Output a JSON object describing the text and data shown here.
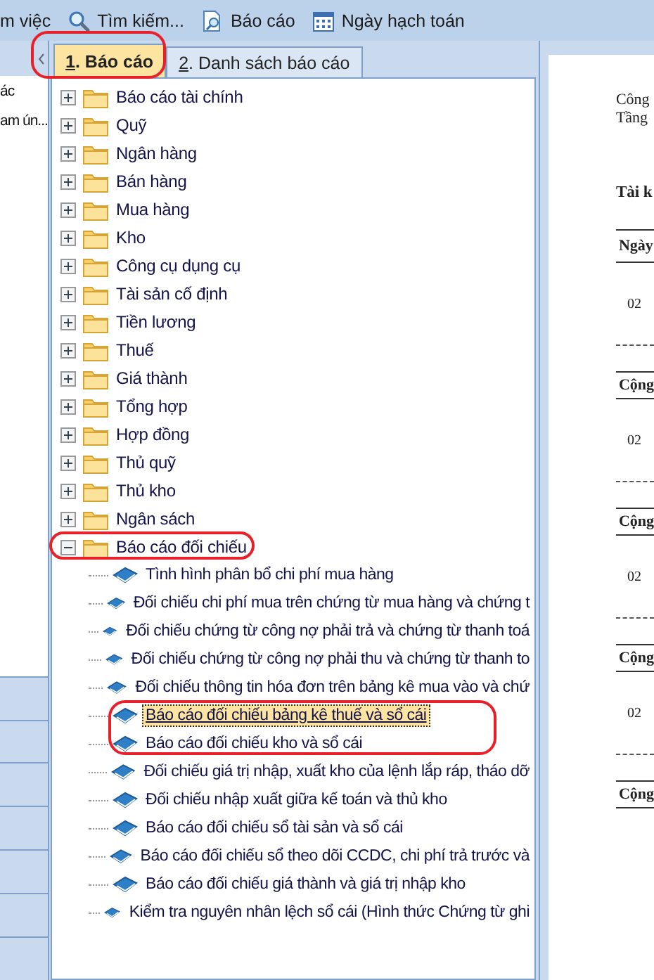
{
  "toolbar": [
    {
      "kind": "text",
      "label": "m việc"
    },
    {
      "kind": "search",
      "label": "Tìm kiếm..."
    },
    {
      "kind": "report",
      "label": "Báo cáo"
    },
    {
      "kind": "calendar",
      "label": "Ngày hạch toán"
    }
  ],
  "left_panel": {
    "items": [
      "ác",
      "am ún..."
    ]
  },
  "tabs": [
    {
      "number": "1",
      "label": ". Báo cáo",
      "selected": true
    },
    {
      "number": "2",
      "label": ". Danh sách báo cáo",
      "selected": false
    }
  ],
  "tree": [
    {
      "kind": "folder",
      "label": "Báo cáo tài chính",
      "expanded": false
    },
    {
      "kind": "folder",
      "label": "Quỹ",
      "expanded": false
    },
    {
      "kind": "folder",
      "label": "Ngân hàng",
      "expanded": false
    },
    {
      "kind": "folder",
      "label": "Bán hàng",
      "expanded": false
    },
    {
      "kind": "folder",
      "label": "Mua hàng",
      "expanded": false
    },
    {
      "kind": "folder",
      "label": "Kho",
      "expanded": false
    },
    {
      "kind": "folder",
      "label": "Công cụ dụng cụ",
      "expanded": false
    },
    {
      "kind": "folder",
      "label": "Tài sản cố định",
      "expanded": false
    },
    {
      "kind": "folder",
      "label": "Tiền lương",
      "expanded": false
    },
    {
      "kind": "folder",
      "label": "Thuế",
      "expanded": false
    },
    {
      "kind": "folder",
      "label": "Giá thành",
      "expanded": false
    },
    {
      "kind": "folder",
      "label": "Tổng hợp",
      "expanded": false
    },
    {
      "kind": "folder",
      "label": "Hợp đồng",
      "expanded": false
    },
    {
      "kind": "folder",
      "label": "Thủ quỹ",
      "expanded": false
    },
    {
      "kind": "folder",
      "label": "Thủ kho",
      "expanded": false
    },
    {
      "kind": "folder",
      "label": "Ngân sách",
      "expanded": false
    },
    {
      "kind": "folder",
      "label": "Báo cáo đối chiếu",
      "expanded": true,
      "children": [
        {
          "kind": "report",
          "label": "Tình hình phân bổ chi phí mua hàng",
          "selected": false
        },
        {
          "kind": "report",
          "label": "Đối chiếu chi phí mua trên chứng từ mua hàng và chứng t",
          "selected": false
        },
        {
          "kind": "report",
          "label": "Đối chiếu chứng từ công nợ phải trả và chứng từ thanh toá",
          "selected": false
        },
        {
          "kind": "report",
          "label": "Đối chiếu chứng từ công nợ phải thu và chứng từ thanh to",
          "selected": false
        },
        {
          "kind": "report",
          "label": "Đối chiếu thông tin hóa đơn trên bảng kê mua vào và chứ",
          "selected": false
        },
        {
          "kind": "report",
          "label": "Báo cáo đối chiếu bảng kê thuế và sổ cái",
          "selected": true
        },
        {
          "kind": "report",
          "label": "Báo cáo đối chiếu kho và sổ cái",
          "selected": false
        },
        {
          "kind": "report",
          "label": "Đối chiếu giá trị nhập, xuất kho của lệnh lắp ráp, tháo dỡ",
          "selected": false
        },
        {
          "kind": "report",
          "label": "Đối chiếu nhập xuất giữa kế toán và thủ kho",
          "selected": false
        },
        {
          "kind": "report",
          "label": "Báo cáo đối chiếu sổ tài sản và sổ cái",
          "selected": false
        },
        {
          "kind": "report",
          "label": "Báo cáo đối chiếu sổ theo dõi CCDC, chi phí trả trước và",
          "selected": false
        },
        {
          "kind": "report",
          "label": "Báo cáo đối chiếu giá thành và giá trị nhập kho",
          "selected": false
        },
        {
          "kind": "report",
          "label": "Kiểm tra nguyên nhân lệch sổ cái (Hình thức Chứng từ ghi",
          "selected": false
        }
      ]
    }
  ],
  "preview": {
    "header_lines": [
      "Công",
      "Tầng"
    ],
    "title": "Tài k",
    "rows": [
      {
        "kind": "header",
        "text": "Ngày"
      },
      {
        "kind": "date",
        "text": "02"
      },
      {
        "kind": "total",
        "text": "Cộng"
      },
      {
        "kind": "date",
        "text": "02"
      },
      {
        "kind": "total",
        "text": "Cộng"
      },
      {
        "kind": "date",
        "text": "02"
      },
      {
        "kind": "total",
        "text": "Cộng"
      },
      {
        "kind": "date",
        "text": "02"
      },
      {
        "kind": "total",
        "text": "Cộng"
      }
    ]
  },
  "annotations": [
    {
      "kind": "tab"
    },
    {
      "kind": "folder"
    },
    {
      "kind": "items"
    }
  ]
}
